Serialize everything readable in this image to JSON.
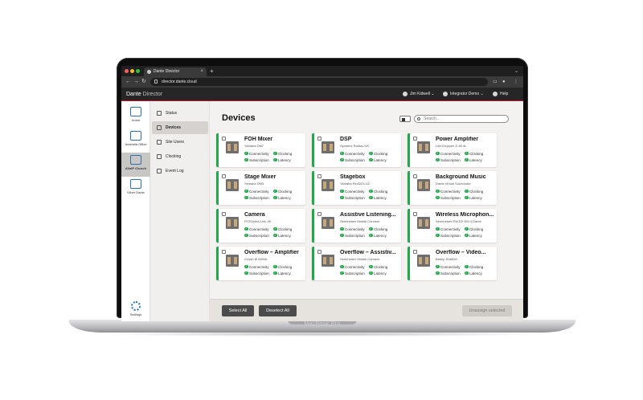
{
  "device_label": "MacBook Pro",
  "browser": {
    "tab_title": "Dante Director",
    "url": "director.dante.cloud"
  },
  "header": {
    "brand": "Dante",
    "brand_suffix": "Director",
    "user": "Jim Kidwell",
    "org": "Integrator Demo",
    "help": "Help"
  },
  "rail": {
    "items": [
      {
        "label": "Home"
      },
      {
        "label": "Australia Office"
      },
      {
        "label": "AVoIP Church"
      },
      {
        "label": "Other Dante"
      }
    ],
    "settings": "Settings"
  },
  "nav": {
    "items": [
      {
        "label": "Status"
      },
      {
        "label": "Devices"
      },
      {
        "label": "Site Users"
      },
      {
        "label": "Clocking"
      },
      {
        "label": "Event Log"
      }
    ]
  },
  "main": {
    "title": "Devices",
    "search_placeholder": "Search..."
  },
  "status_labels": {
    "connectivity": "Connectivity",
    "clocking": "Clocking",
    "subscription": "Subscription",
    "latency": "Latency"
  },
  "devices": [
    {
      "name": "FOH Mixer",
      "model": "Yamaha DM7"
    },
    {
      "name": "DSP",
      "model": "Symetrix Radius NX"
    },
    {
      "name": "Power Amplifier",
      "model": "Lab.Gruppen D 80:4L"
    },
    {
      "name": "Stage Mixer",
      "model": "Yamaha DM3"
    },
    {
      "name": "Stagebox",
      "model": "Yamaha Rio3224-D2"
    },
    {
      "name": "Background Music",
      "model": "Dante Virtual Soundcard"
    },
    {
      "name": "Camera",
      "model": "PTZOptics Link 4K"
    },
    {
      "name": "Assistive Listening...",
      "model": "Sennheiser Mobile Connect"
    },
    {
      "name": "Wireless Microphon...",
      "model": "Sennheiser EW-DX EM 4 Dante"
    },
    {
      "name": "Overflow – Amplifier",
      "model": "Crown IEX000A"
    },
    {
      "name": "Overflow – Assistiv...",
      "model": "Sennheiser Mobile Connect"
    },
    {
      "name": "Overflow – Video...",
      "model": "Biamp IDA8DH"
    }
  ],
  "footer": {
    "select_all": "Select All",
    "deselect_all": "Deselect All",
    "unassign": "Unassign selected"
  }
}
